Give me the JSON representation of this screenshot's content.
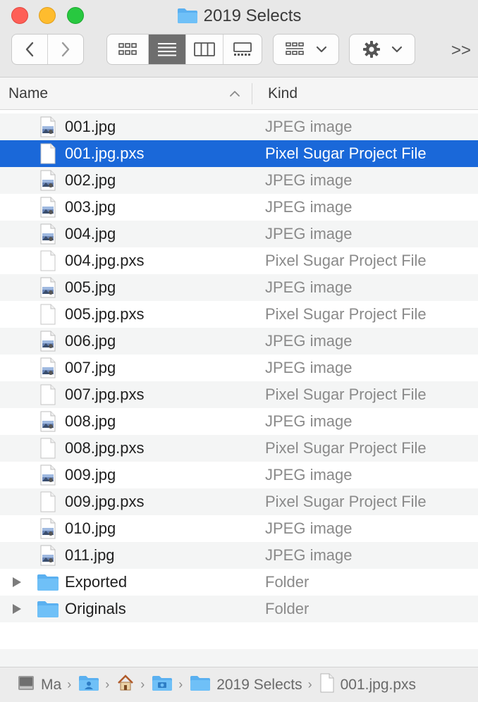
{
  "window": {
    "title": "2019 Selects"
  },
  "toolbar": {
    "back_icon": "chevron-left-icon",
    "forward_icon": "chevron-right-icon",
    "view_modes": [
      "icon-view",
      "list-view",
      "column-view",
      "gallery-view"
    ],
    "active_view": "list-view",
    "group_icon": "group-icon",
    "action_icon": "gear-icon",
    "overflow_label": ">>"
  },
  "columns": {
    "name": "Name",
    "kind": "Kind"
  },
  "files": [
    {
      "name": "001.jpg",
      "kind": "JPEG image",
      "type": "jpg"
    },
    {
      "name": "001.jpg.pxs",
      "kind": "Pixel Sugar Project File",
      "type": "doc",
      "selected": true
    },
    {
      "name": "002.jpg",
      "kind": "JPEG image",
      "type": "jpg"
    },
    {
      "name": "003.jpg",
      "kind": "JPEG image",
      "type": "jpg"
    },
    {
      "name": "004.jpg",
      "kind": "JPEG image",
      "type": "jpg"
    },
    {
      "name": "004.jpg.pxs",
      "kind": "Pixel Sugar Project File",
      "type": "doc"
    },
    {
      "name": "005.jpg",
      "kind": "JPEG image",
      "type": "jpg"
    },
    {
      "name": "005.jpg.pxs",
      "kind": "Pixel Sugar Project File",
      "type": "doc"
    },
    {
      "name": "006.jpg",
      "kind": "JPEG image",
      "type": "jpg"
    },
    {
      "name": "007.jpg",
      "kind": "JPEG image",
      "type": "jpg"
    },
    {
      "name": "007.jpg.pxs",
      "kind": "Pixel Sugar Project File",
      "type": "doc"
    },
    {
      "name": "008.jpg",
      "kind": "JPEG image",
      "type": "jpg"
    },
    {
      "name": "008.jpg.pxs",
      "kind": "Pixel Sugar Project File",
      "type": "doc"
    },
    {
      "name": "009.jpg",
      "kind": "JPEG image",
      "type": "jpg"
    },
    {
      "name": "009.jpg.pxs",
      "kind": "Pixel Sugar Project File",
      "type": "doc"
    },
    {
      "name": "010.jpg",
      "kind": "JPEG image",
      "type": "jpg"
    },
    {
      "name": "011.jpg",
      "kind": "JPEG image",
      "type": "jpg"
    },
    {
      "name": "Exported",
      "kind": "Folder",
      "type": "folder"
    },
    {
      "name": "Originals",
      "kind": "Folder",
      "type": "folder"
    }
  ],
  "pathbar": [
    {
      "label": "Ma",
      "icon": "hard-drive-icon"
    },
    {
      "label": "",
      "icon": "user-folder-icon"
    },
    {
      "label": "",
      "icon": "home-icon"
    },
    {
      "label": "",
      "icon": "pictures-folder-icon"
    },
    {
      "label": "2019 Selects",
      "icon": "folder-icon"
    },
    {
      "label": "001.jpg.pxs",
      "icon": "document-icon"
    }
  ],
  "colors": {
    "selection": "#1a68d9",
    "folder": "#5ab0f0",
    "close": "#fe5f57",
    "minimize": "#febc2e",
    "maximize": "#28c840"
  }
}
